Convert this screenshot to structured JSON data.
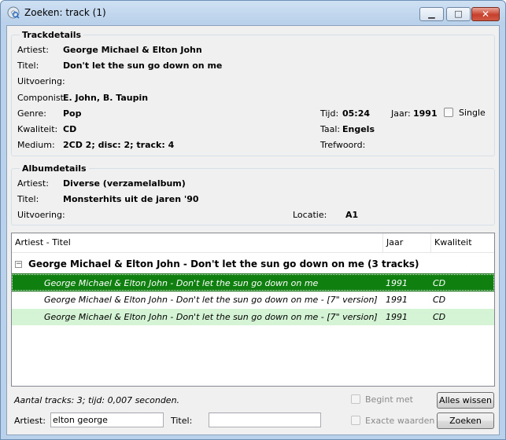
{
  "window": {
    "title": "Zoeken: track (1)"
  },
  "controls": {
    "minimize": "▁",
    "maximize": "□",
    "close": "✕"
  },
  "trackdetails": {
    "title": "Trackdetails",
    "artiest_label": "Artiest:",
    "artiest": "George Michael & Elton John",
    "titel_label": "Titel:",
    "titel": "Don't let the sun go down on me",
    "uitvoering_label": "Uitvoering:",
    "componist_label": "Componist:",
    "componist": "E. John, B. Taupin",
    "genre_label": "Genre:",
    "genre": "Pop",
    "kwaliteit_label": "Kwaliteit:",
    "kwaliteit": "CD",
    "medium_label": "Medium:",
    "medium": "2CD 2; disc: 2; track: 4",
    "tijd_label": "Tijd:",
    "tijd": "05:24",
    "jaar_label": "Jaar:",
    "jaar": "1991",
    "single_label": "Single",
    "taal_label": "Taal:",
    "taal": "Engels",
    "trefwoord_label": "Trefwoord:"
  },
  "albumdetails": {
    "title": "Albumdetails",
    "artiest_label": "Artiest:",
    "artiest": "Diverse (verzamelalbum)",
    "titel_label": "Titel:",
    "titel": "Monsterhits uit de jaren '90",
    "uitvoering_label": "Uitvoering:",
    "locatie_label": "Locatie:",
    "locatie": "A1"
  },
  "list": {
    "columns": [
      "Artiest - Titel",
      "Jaar",
      "Kwaliteit"
    ],
    "group": "George Michael & Elton John - Don't let the sun go down on me (3 tracks)",
    "expander": "−",
    "rows": [
      {
        "title": "George Michael & Elton John - Don't let the sun go down on me",
        "jaar": "1991",
        "kwaliteit": "CD"
      },
      {
        "title": "George Michael & Elton John - Don't let the sun go down on me - [7\" version]",
        "jaar": "1991",
        "kwaliteit": "CD"
      },
      {
        "title": "George Michael & Elton John - Don't let the sun go down on me - [7\" version]",
        "jaar": "1991",
        "kwaliteit": "CD"
      }
    ]
  },
  "status": "Aantal tracks: 3; tijd: 0,007 seconden.",
  "search": {
    "artiest_label": "Artiest:",
    "artiest_value": "elton george",
    "titel_label": "Titel:",
    "titel_value": "",
    "begint_met": "Begint met",
    "exacte_waarden": "Exacte waarden",
    "alles_wissen": "Alles wissen",
    "zoeken": "Zoeken"
  }
}
